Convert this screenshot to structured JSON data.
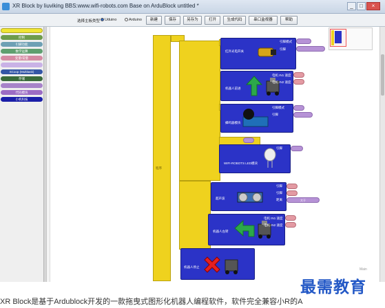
{
  "window": {
    "title": "XR Block by liuviking BBS:www.wifi-robots.com Base on ArduBlock untitled *",
    "controls": [
      "_",
      "□",
      "×"
    ]
  },
  "toolbar": {
    "board_label": "选择主板类型",
    "board_options": [
      "Uduino",
      "Arduino"
    ],
    "buttons": [
      "新建",
      "保存",
      "另存为",
      "打开",
      "生成代码",
      "串口监视器",
      "帮助"
    ]
  },
  "palette": {
    "categories": [
      {
        "label": "",
        "color": "#f0e535"
      },
      {
        "label": "控制",
        "color": "#6e9c4c"
      },
      {
        "label": "引脚功能",
        "color": "#6ea0b4"
      },
      {
        "label": "数学运算",
        "color": "#5f9f6f"
      },
      {
        "label": "变量/常量",
        "color": "#d58aa3"
      },
      {
        "label": "",
        "color": "#c9b2e6"
      },
      {
        "label": "SCoop (Multitask)",
        "color": "#3456a6"
      },
      {
        "label": "存储",
        "color": "#3a6b3a"
      },
      {
        "label": "",
        "color": "#a783c9"
      },
      {
        "label": "代码模块",
        "color": "#9c6cc4"
      },
      {
        "label": "小机科技",
        "color": "#1b1fa8"
      }
    ]
  },
  "canvas": {
    "program_label": "程序",
    "status": "Main",
    "blocks": {
      "b1": {
        "title": "红外光电开关",
        "labels": [
          "引脚模式",
          "引脚"
        ]
      },
      "b2": {
        "title": "机器人前进",
        "labels": [
          "电机 IN1 速度",
          "电机 IN2 速度"
        ]
      },
      "b3": {
        "title": "蜂鸣器模块",
        "labels": [
          "引脚模式",
          "引脚"
        ]
      },
      "b4": {
        "title": "WIFI-ROBOTS LED模块",
        "labels": [
          "引脚"
        ]
      },
      "b5": {
        "title": "超声波",
        "labels": [
          "引脚",
          "引脚",
          "距离",
          "大于"
        ]
      },
      "b6": {
        "title": "机器人左转",
        "labels": [
          "电机 IN1 速度",
          "电机 IN2 速度"
        ]
      },
      "b7": {
        "title": "机器人停止"
      }
    }
  },
  "caption": {
    "text": "XR Block是基于Ardublock开发的一款拖曳式图形化机器人编程软件，软件完全兼容小R的A",
    "watermark": "最需教育"
  },
  "colors": {
    "block_yellow": "#efd21e",
    "block_blue": "#2b33c7",
    "pill_lavender": "#b692d6",
    "pill_pink": "#e39aa3"
  }
}
